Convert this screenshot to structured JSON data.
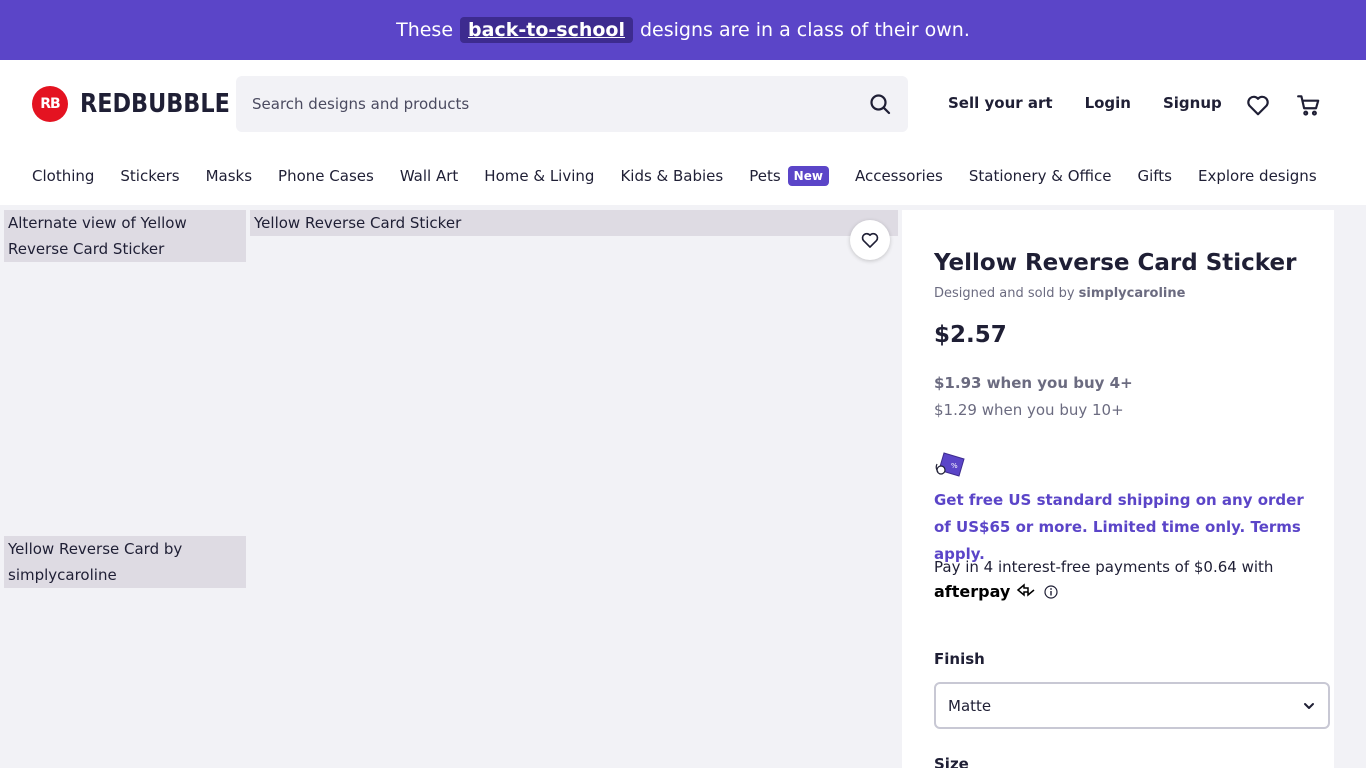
{
  "promo": {
    "before": "These",
    "link": "back-to-school",
    "after": "designs are in a class of their own."
  },
  "header": {
    "logo_mark": "RB",
    "logo_text": "REDBUBBLE",
    "search_placeholder": "Search designs and products",
    "links": {
      "sell": "Sell your art",
      "login": "Login",
      "signup": "Signup"
    },
    "icons": [
      "search-icon",
      "heart-icon",
      "cart-icon"
    ]
  },
  "categories": [
    "Clothing",
    "Stickers",
    "Masks",
    "Phone Cases",
    "Wall Art",
    "Home & Living",
    "Kids & Babies",
    "Pets",
    "Accessories",
    "Stationery & Office",
    "Gifts",
    "Explore designs"
  ],
  "pets_badge": "New",
  "gallery": {
    "thumb1_alt": "Alternate view of Yellow Reverse Card Sticker",
    "main_alt": "Yellow Reverse Card Sticker",
    "thumb2_alt": "Yellow Reverse Card by simplycaroline"
  },
  "product": {
    "title": "Yellow Reverse Card Sticker",
    "byline_prefix": "Designed and sold by",
    "artist": "simplycaroline",
    "price": "$2.57",
    "tier1": "$1.93 when you buy 4+",
    "tier2": "$1.29 when you buy 10+",
    "shipping": "Get free US standard shipping on any order of US$65 or more. Limited time only. Terms apply.",
    "pay_text": "Pay in 4 interest-free payments of $0.64 with",
    "afterpay": "afterpay",
    "finish_label": "Finish",
    "finish_value": "Matte",
    "size_label": "Size"
  },
  "colors": {
    "brand_purple": "#5b45c8",
    "logo_red": "#e41321",
    "text_dark": "#1f1f35"
  }
}
